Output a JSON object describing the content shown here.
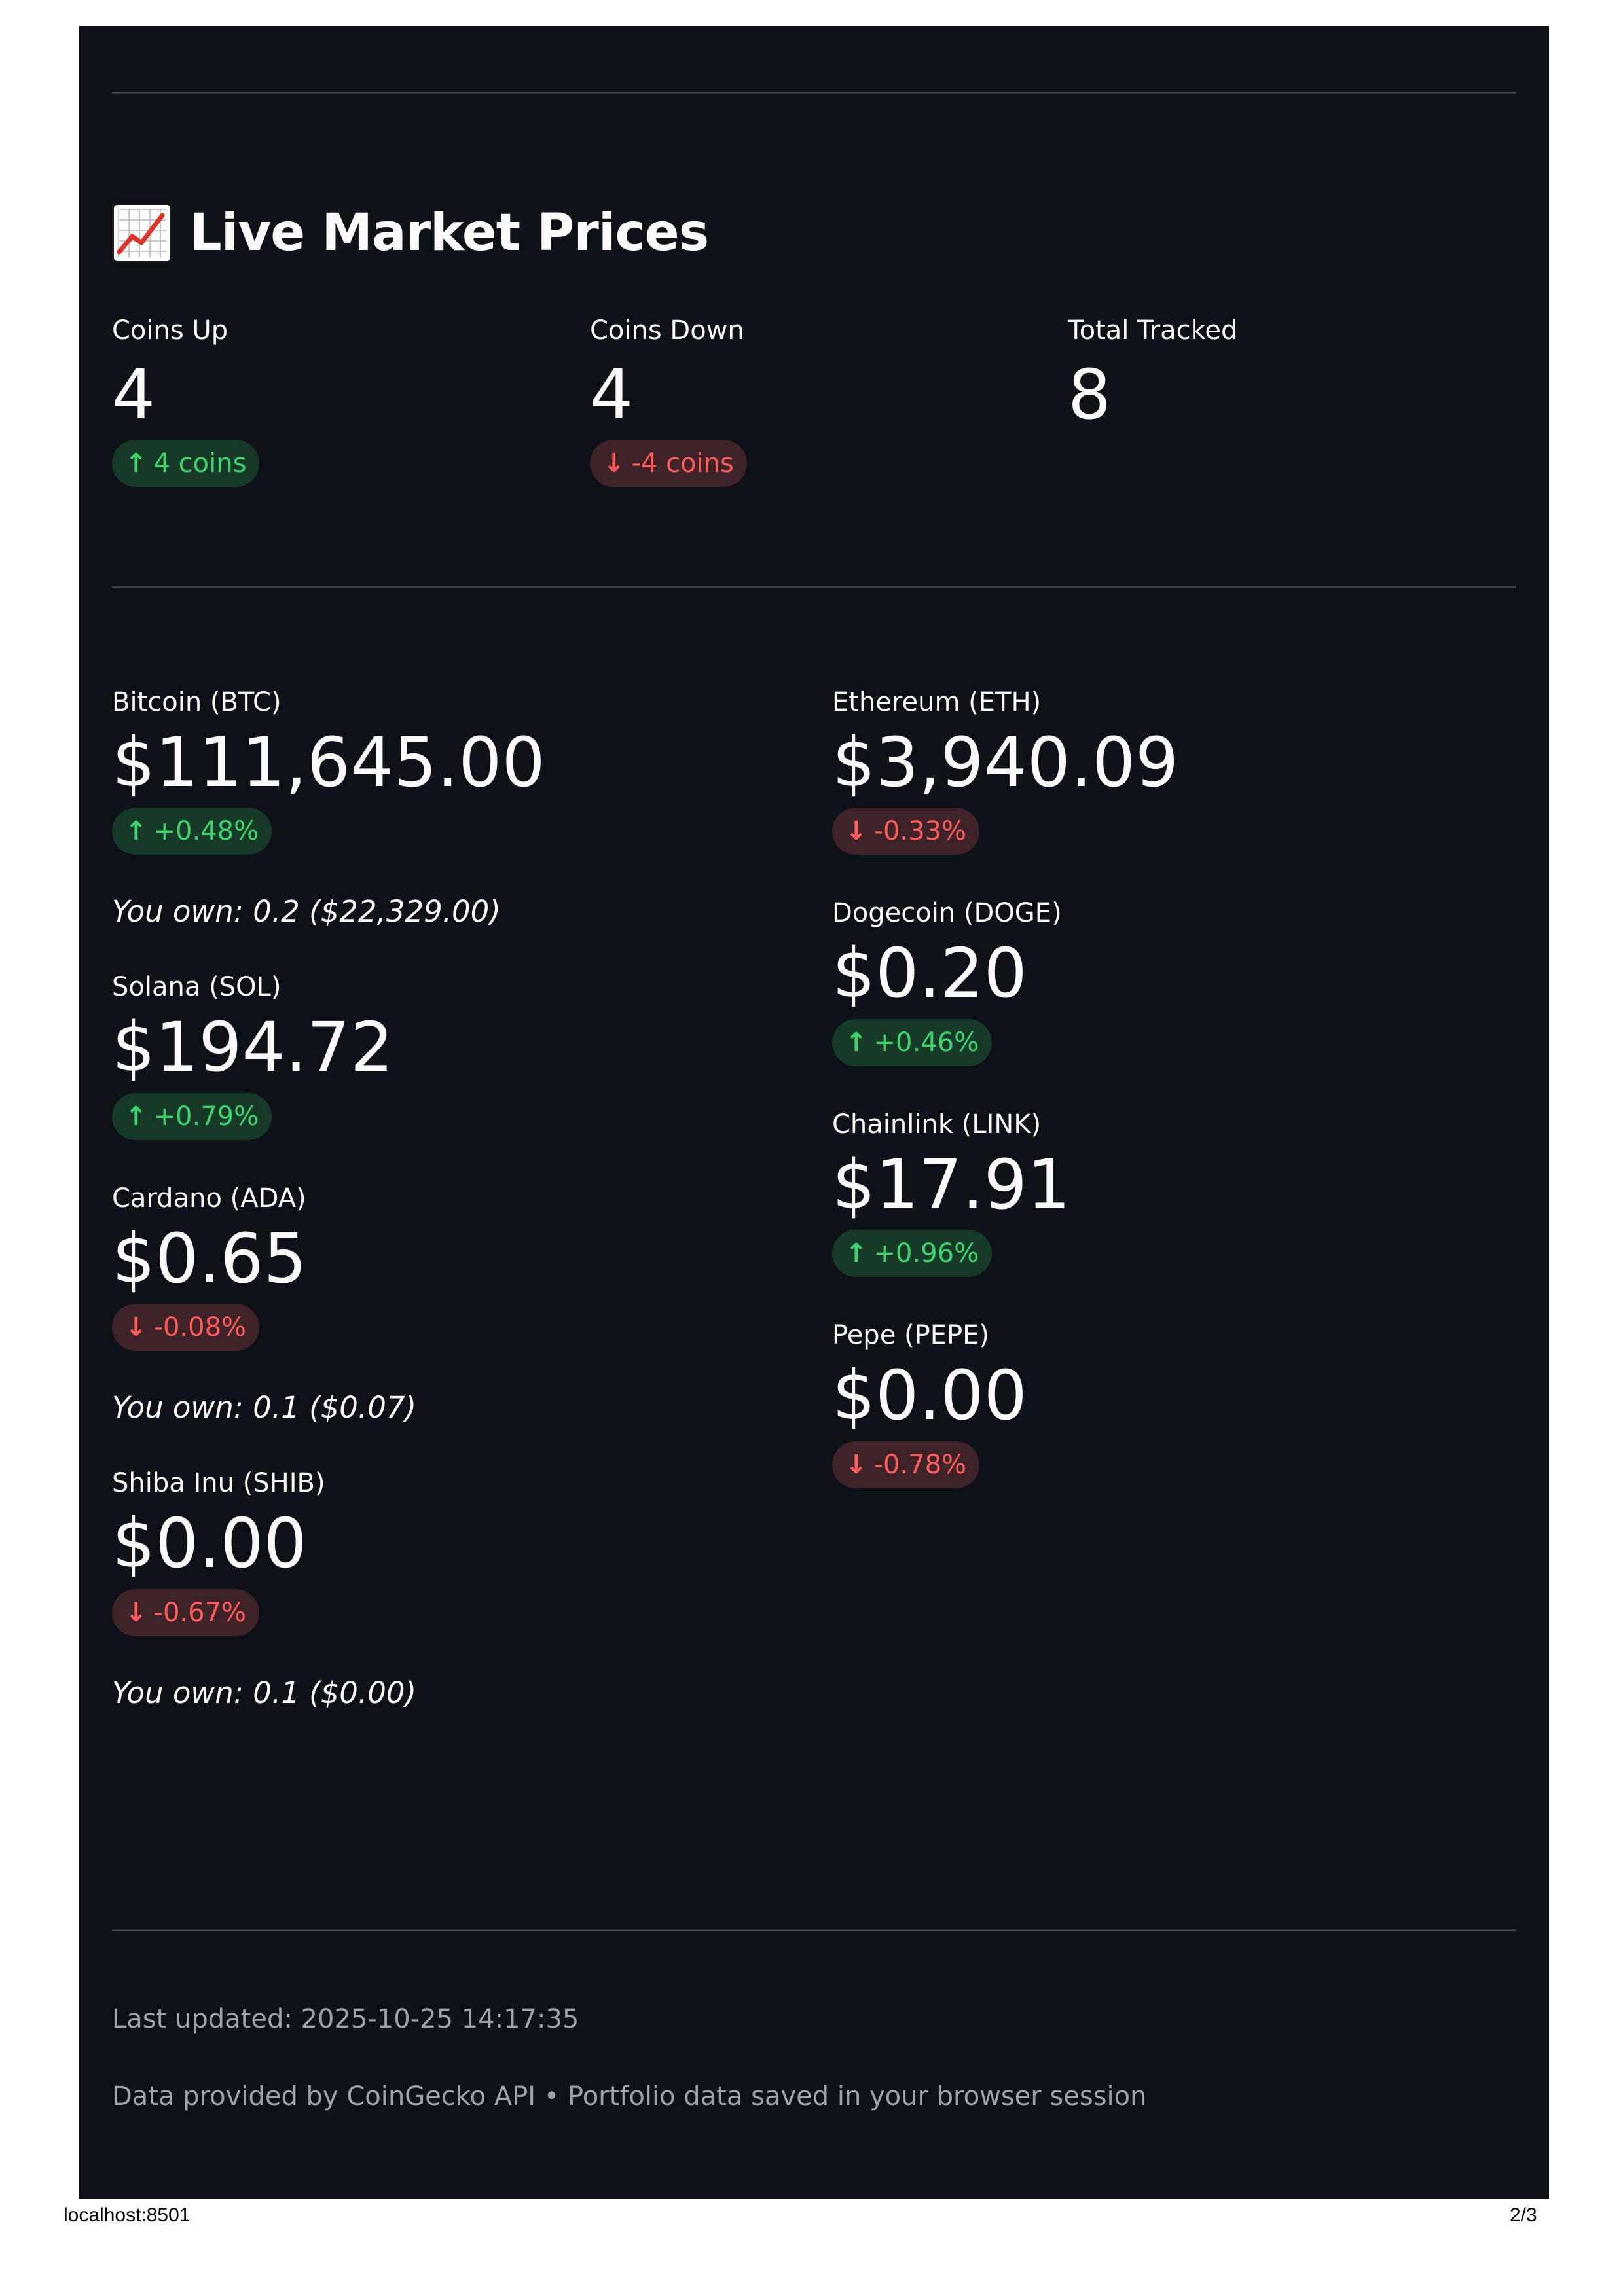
{
  "header": {
    "title": "Live Market Prices",
    "icon": "chart-increasing-icon"
  },
  "summary": [
    {
      "label": "Coins Up",
      "value": "4",
      "delta": "4 coins",
      "direction": "up"
    },
    {
      "label": "Coins Down",
      "value": "4",
      "delta": "-4 coins",
      "direction": "down"
    },
    {
      "label": "Total Tracked",
      "value": "8"
    }
  ],
  "left_column": [
    {
      "label": "Bitcoin (BTC)",
      "price": "$111,645.00",
      "delta": "+0.48%",
      "direction": "up",
      "owned": "You own: 0.2 ($22,329.00)"
    },
    {
      "label": "Solana (SOL)",
      "price": "$194.72",
      "delta": "+0.79%",
      "direction": "up"
    },
    {
      "label": "Cardano (ADA)",
      "price": "$0.65",
      "delta": "-0.08%",
      "direction": "down",
      "owned": "You own: 0.1 ($0.07)"
    },
    {
      "label": "Shiba Inu (SHIB)",
      "price": "$0.00",
      "delta": "-0.67%",
      "direction": "down",
      "owned": "You own: 0.1 ($0.00)"
    }
  ],
  "right_column": [
    {
      "label": "Ethereum (ETH)",
      "price": "$3,940.09",
      "delta": "-0.33%",
      "direction": "down"
    },
    {
      "label": "Dogecoin (DOGE)",
      "price": "$0.20",
      "delta": "+0.46%",
      "direction": "up"
    },
    {
      "label": "Chainlink (LINK)",
      "price": "$17.91",
      "delta": "+0.96%",
      "direction": "up"
    },
    {
      "label": "Pepe (PEPE)",
      "price": "$0.00",
      "delta": "-0.78%",
      "direction": "down"
    }
  ],
  "footer": {
    "last_updated": "Last updated: 2025-10-25 14:17:35",
    "attribution": "Data provided by CoinGecko API • Portfolio data saved in your browser session"
  },
  "print_footer": {
    "url": "localhost:8501",
    "page": "2/3"
  },
  "colors": {
    "background": "#0e1117",
    "up": "#3dd56d",
    "down": "#ff5b5b",
    "up_bg": "#173928",
    "down_bg": "#3e2428"
  },
  "icons": {
    "up": "arrow-up-icon",
    "down": "arrow-down-icon"
  }
}
